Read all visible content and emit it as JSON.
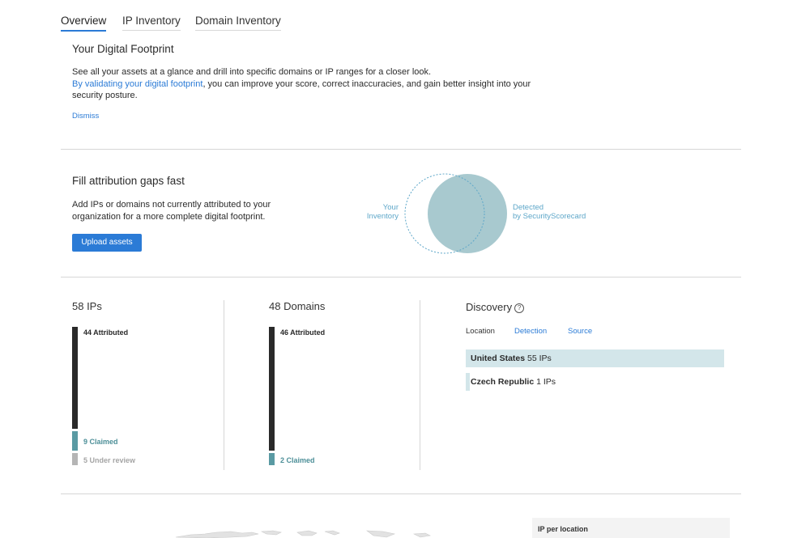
{
  "tabs": [
    {
      "label": "Overview",
      "active": true
    },
    {
      "label": "IP Inventory",
      "active": false
    },
    {
      "label": "Domain Inventory",
      "active": false
    }
  ],
  "footprint": {
    "title": "Your Digital Footprint",
    "line1": "See all your assets at a glance and drill into specific domains or IP ranges for a closer look.",
    "link_text": "By validating your digital footprint",
    "line2_rest": ", you can improve your score, correct inaccuracies, and gain better insight into your",
    "line3": "security posture.",
    "dismiss": "Dismiss"
  },
  "attribution": {
    "title": "Fill attribution gaps fast",
    "desc_line1": "Add IPs or domains not currently attributed to your",
    "desc_line2": "organization for a more complete digital footprint.",
    "upload_button": "Upload assets",
    "venn_left_line1": "Your",
    "venn_left_line2": "Inventory",
    "venn_right_line1": "Detected",
    "venn_right_line2": "by SecurityScorecard"
  },
  "ips": {
    "title": "58 IPs",
    "attributed": "44 Attributed",
    "claimed": "9 Claimed",
    "under_review": "5 Under review"
  },
  "domains": {
    "title": "48 Domains",
    "attributed": "46 Attributed",
    "claimed": "2 Claimed"
  },
  "discovery": {
    "title": "Discovery",
    "help_icon": "?",
    "tabs": [
      "Location",
      "Detection",
      "Source"
    ],
    "locations": [
      {
        "country": "United States",
        "count": "55 IPs"
      },
      {
        "country": "Czech Republic",
        "count": "1 IPs"
      }
    ]
  },
  "map": {
    "panel_title": "IP per location"
  },
  "colors": {
    "accent": "#2b7bd6",
    "bar_attributed": "#2a2a2a",
    "bar_claimed": "#5a9aa3",
    "bar_review": "#b5b5b5",
    "venn_fill": "#a8c9cf",
    "row_highlight": "#d3e6ea"
  }
}
